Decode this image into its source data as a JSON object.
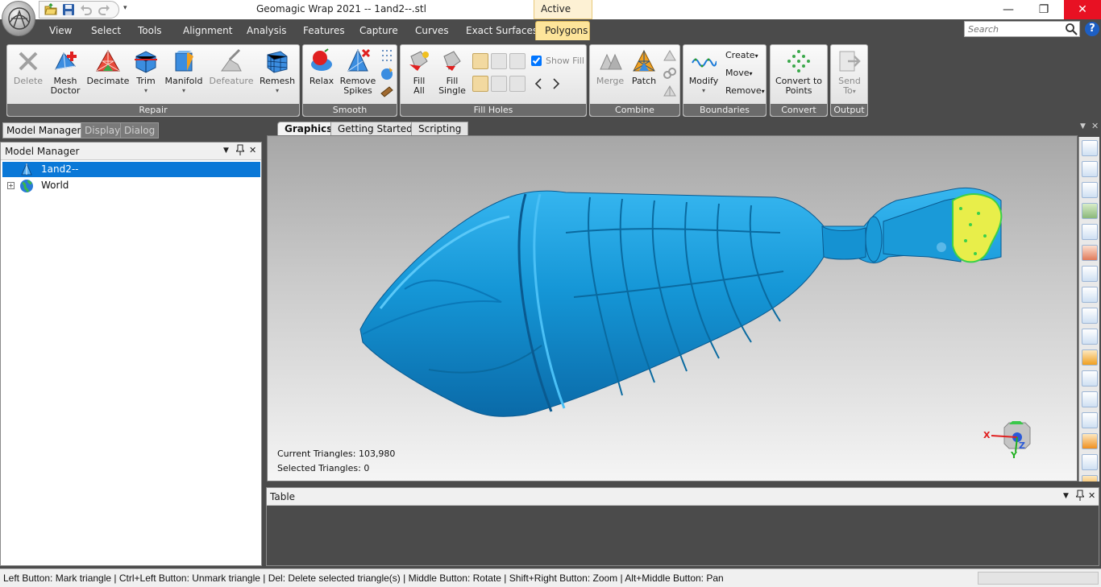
{
  "window": {
    "title": "Geomagic Wrap 2021 -- 1and2--.stl",
    "context_tab": "Active",
    "minimize": "—",
    "restore": "❐",
    "close": "✕"
  },
  "menu": {
    "items": [
      "View",
      "Select",
      "Tools",
      "Alignment",
      "Analysis",
      "Features",
      "Capture",
      "Curves",
      "Exact Surfaces"
    ],
    "active_tab": "Polygons",
    "search_placeholder": "Search",
    "help": "?"
  },
  "ribbon": {
    "groups": {
      "repair": "Repair",
      "smooth": "Smooth",
      "fill_holes": "Fill Holes",
      "combine": "Combine",
      "boundaries": "Boundaries",
      "convert": "Convert",
      "output": "Output"
    },
    "buttons": {
      "delete": "Delete",
      "mesh_doctor_1": "Mesh",
      "mesh_doctor_2": "Doctor",
      "decimate": "Decimate",
      "trim": "Trim",
      "manifold": "Manifold",
      "defeature": "Defeature",
      "remesh": "Remesh",
      "relax": "Relax",
      "remove_spikes_1": "Remove",
      "remove_spikes_2": "Spikes",
      "fill_all_1": "Fill",
      "fill_all_2": "All",
      "fill_single_1": "Fill",
      "fill_single_2": "Single",
      "show_fill": "Show Fill",
      "merge": "Merge",
      "patch": "Patch",
      "modify": "Modify",
      "create": "Create",
      "move": "Move",
      "remove": "Remove",
      "convert_1": "Convert to",
      "convert_2": "Points",
      "send_1": "Send",
      "send_2": "To"
    },
    "dropdown_glyph": "▾",
    "show_fill_checked": true
  },
  "panels": {
    "tabs": [
      "Model Manager",
      "Display",
      "Dialog"
    ],
    "model_manager": {
      "title": "Model Manager",
      "tree": [
        {
          "label": "1and2--",
          "selected": true
        },
        {
          "label": "World",
          "selected": false
        }
      ],
      "expander": "+"
    },
    "header_icons": {
      "dropdown": "▼",
      "pin": "📌",
      "close": "✕"
    }
  },
  "document": {
    "tabs": [
      "Graphics",
      "Getting Started",
      "Scripting"
    ],
    "active_tab": "Graphics",
    "stats": {
      "current": "Current Triangles: 103,980",
      "selected": "Selected Triangles: 0"
    },
    "triad": {
      "x": "X",
      "y": "Y",
      "z": "Z"
    },
    "model_color": "#1a9ad8",
    "highlight_color": "#e8ee4a"
  },
  "table_panel": {
    "title": "Table"
  },
  "status": {
    "text": "Left Button: Mark triangle | Ctrl+Left Button: Unmark triangle | Del: Delete selected triangle(s) | Middle Button: Rotate | Shift+Right Button: Zoom | Alt+Middle Button: Pan"
  }
}
